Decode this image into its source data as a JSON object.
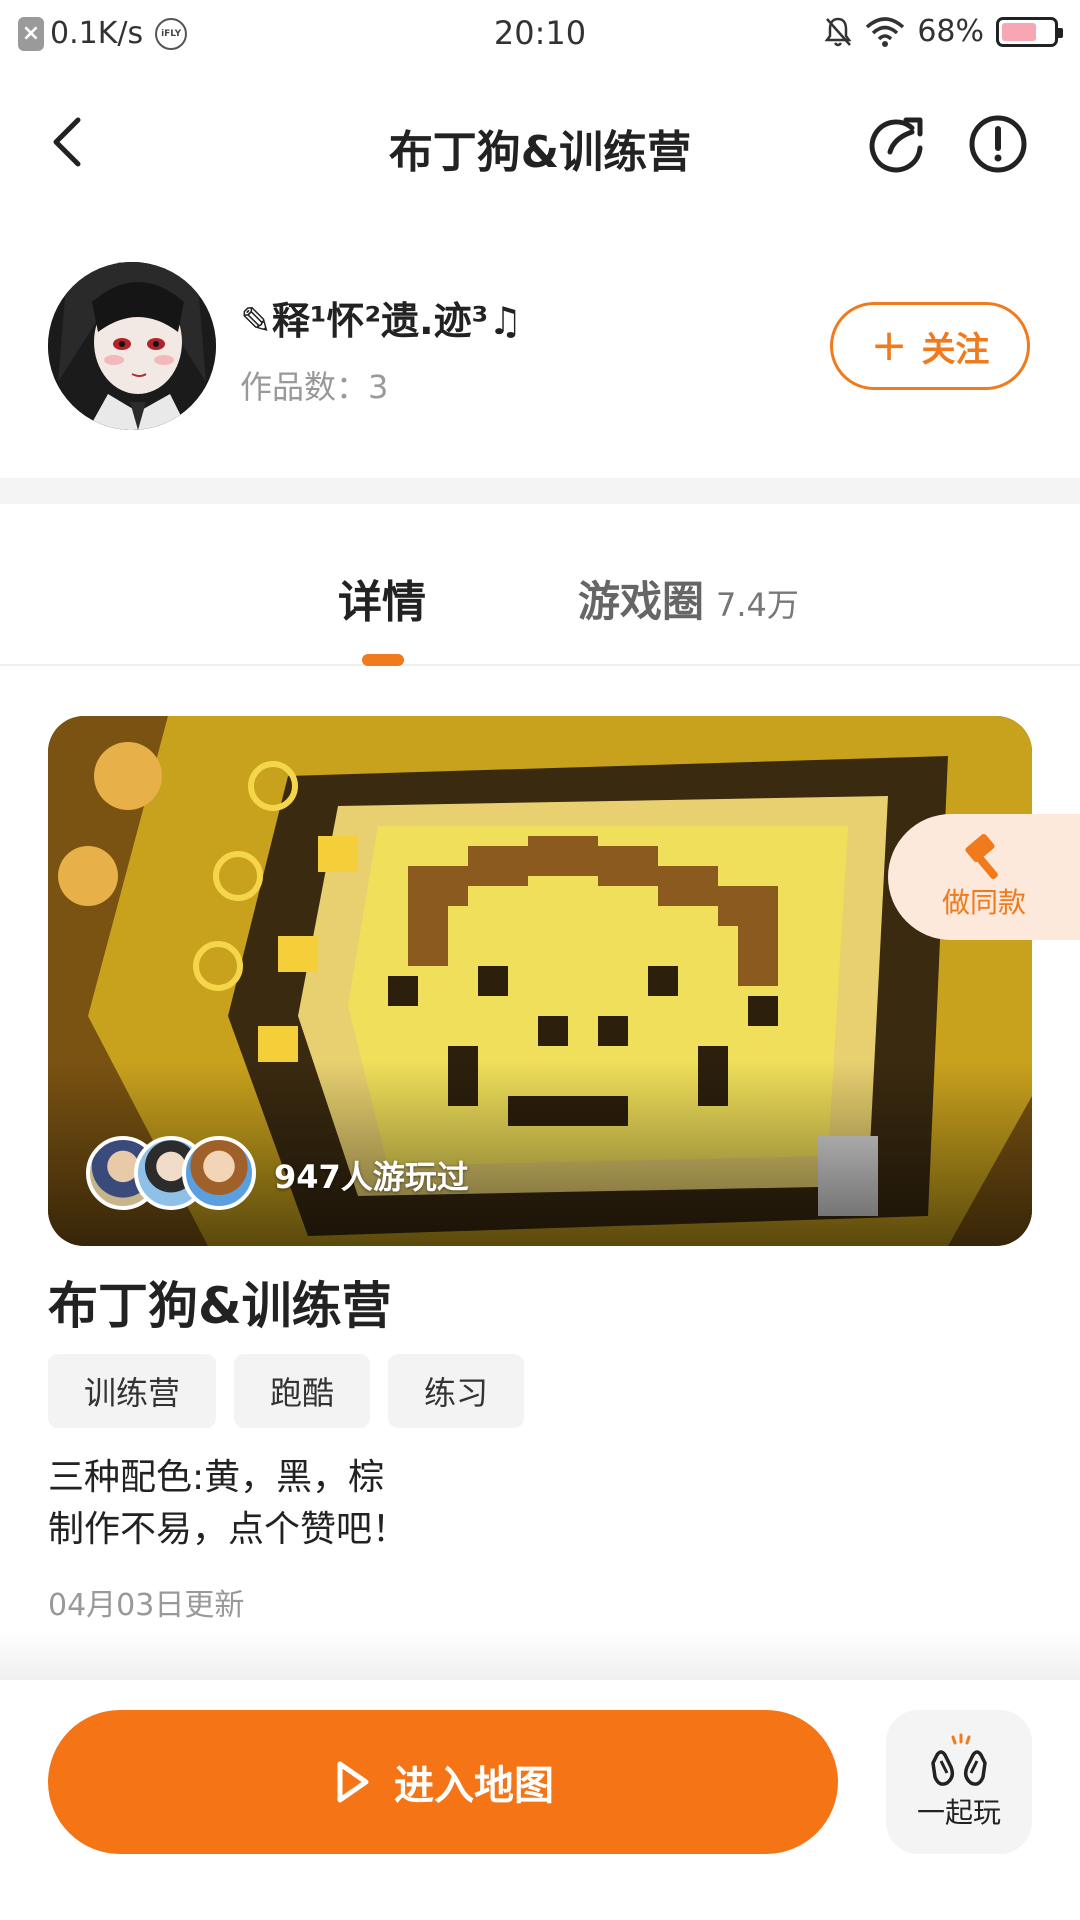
{
  "status_bar": {
    "net_speed": "0.1K/s",
    "input_badge": "iFLY",
    "time": "20:10",
    "battery_percent": "68%",
    "battery_level": 0.68
  },
  "header": {
    "title": "布丁狗&训练营",
    "back_icon": "chevron-left-icon",
    "share_icon": "share-icon",
    "report_icon": "alert-circle-icon"
  },
  "author": {
    "name": "✎释¹怀²遗.迹³♫",
    "works_count": "作品数：3",
    "follow_plus": "+",
    "follow_label": "关注"
  },
  "tabs": {
    "detail": "详情",
    "circle_label": "游戏圈",
    "circle_count": "7.4万"
  },
  "hero": {
    "played_text": "947人游玩过",
    "same_label": "做同款"
  },
  "map": {
    "title": "布丁狗&训练营",
    "tags": [
      "训练营",
      "跑酷",
      "练习"
    ],
    "desc_line1": "三种配色:黄，黑，棕",
    "desc_line2": "制作不易，点个赞吧！",
    "updated": "04月03日更新"
  },
  "bottom": {
    "enter_label": "进入地图",
    "play_together_label": "一起玩"
  },
  "colors": {
    "accent": "#f57415",
    "accent_soft": "#fde8dc",
    "muted_text": "#999999"
  }
}
